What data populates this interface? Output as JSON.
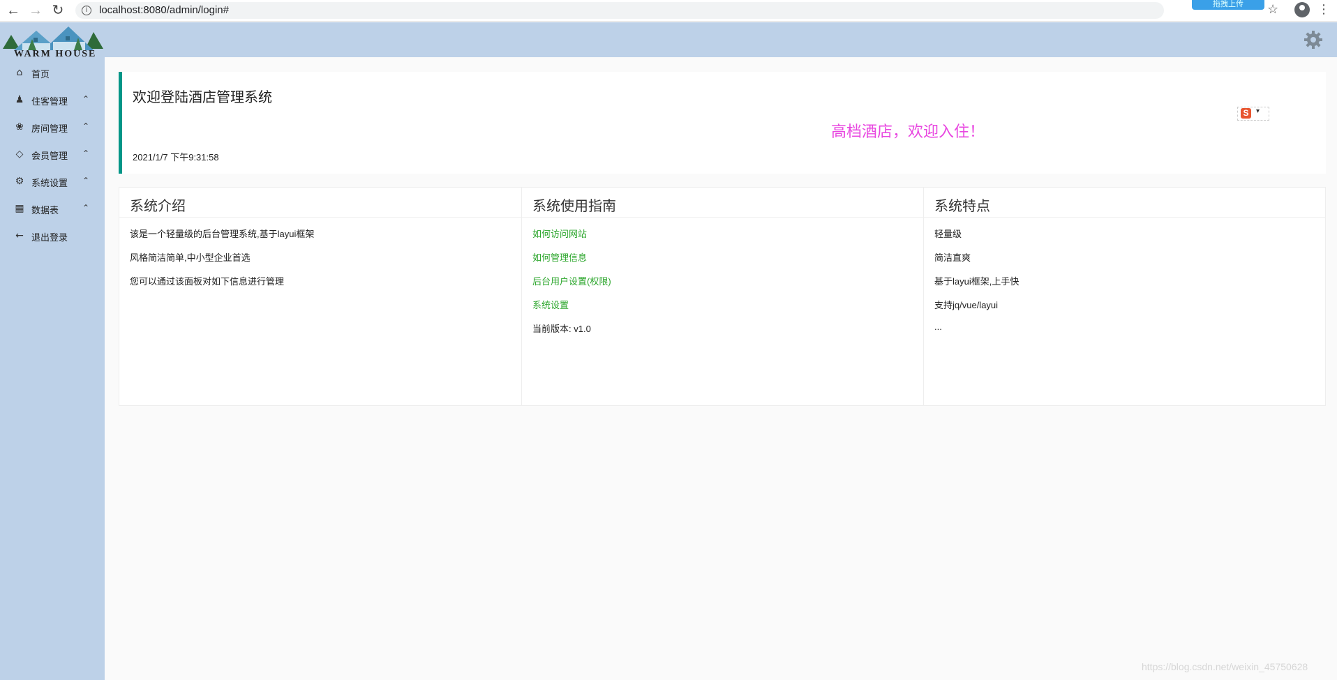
{
  "browser": {
    "url": "localhost:8080/admin/login#",
    "extension_label": "拖拽上传",
    "info_glyph": "i"
  },
  "app": {
    "logo_text": "WARM HOUSE"
  },
  "sidebar": {
    "items": [
      {
        "label": "首页",
        "icon": "home-icon",
        "has_caret": false
      },
      {
        "label": "住客管理",
        "icon": "user-icon",
        "has_caret": true
      },
      {
        "label": "房间管理",
        "icon": "palm-icon",
        "has_caret": true
      },
      {
        "label": "会员管理",
        "icon": "diamond-icon",
        "has_caret": true
      },
      {
        "label": "系统设置",
        "icon": "gear-icon",
        "has_caret": true
      },
      {
        "label": "数据表",
        "icon": "table-icon",
        "has_caret": true
      },
      {
        "label": "退出登录",
        "icon": "arrow-left-icon",
        "has_caret": false
      }
    ]
  },
  "welcome": {
    "title": "欢迎登陆酒店管理系统",
    "datetime": "2021/1/7 下午9:31:58",
    "slogan": "高档酒店，欢迎入住！"
  },
  "cards": [
    {
      "title": "系统介绍",
      "lines": [
        {
          "text": "该是一个轻量级的后台管理系统,基于layui框架",
          "link": false
        },
        {
          "text": "风格简洁简单,中小型企业首选",
          "link": false
        },
        {
          "text": "您可以通过该面板对如下信息进行管理",
          "link": false
        }
      ]
    },
    {
      "title": "系统使用指南",
      "lines": [
        {
          "text": "如何访问网站",
          "link": true
        },
        {
          "text": "如何管理信息",
          "link": true
        },
        {
          "text": "后台用户设置(权限)",
          "link": true
        },
        {
          "text": "系统设置",
          "link": true
        },
        {
          "text": "当前版本: v1.0",
          "link": false
        }
      ]
    },
    {
      "title": "系统特点",
      "lines": [
        {
          "text": "轻量级",
          "link": false
        },
        {
          "text": "简洁直爽",
          "link": false
        },
        {
          "text": "基于layui框架,上手快",
          "link": false
        },
        {
          "text": "支持jq/vue/layui",
          "link": false
        },
        {
          "text": "...",
          "link": false
        }
      ]
    }
  ],
  "watermark": "https://blog.csdn.net/weixin_45750628",
  "colors": {
    "sidebar_bg": "#bdd1e8",
    "accent": "#009688",
    "link": "#2aa52a",
    "slogan": "#e847e0"
  }
}
